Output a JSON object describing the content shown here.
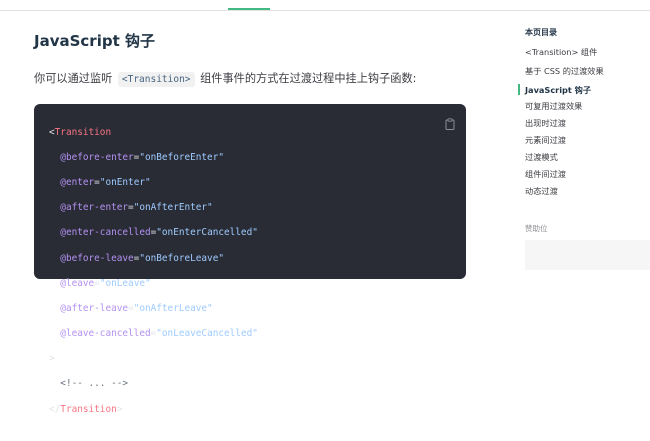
{
  "heading": "JavaScript 钩子",
  "intro": {
    "before": "你可以通过监听 ",
    "code": "<Transition>",
    "after": " 组件事件的方式在过渡过程中挂上钩子函数:"
  },
  "code": {
    "copy_icon": "clipboard-icon",
    "lines": [
      {
        "prefix": "<",
        "tag": "Transition"
      },
      {
        "attr": "@before-enter",
        "value": "\"onBeforeEnter\""
      },
      {
        "attr": "@enter",
        "value": "\"onEnter\""
      },
      {
        "attr": "@after-enter",
        "value": "\"onAfterEnter\""
      },
      {
        "attr": "@enter-cancelled",
        "value": "\"onEnterCancelled\""
      },
      {
        "attr": "@before-leave",
        "value": "\"onBeforeLeave\""
      },
      {
        "attr": "@leave",
        "value": "\"onLeave\""
      },
      {
        "attr": "@after-leave",
        "value": "\"onAfterLeave\""
      },
      {
        "attr": "@leave-cancelled",
        "value": "\"onLeaveCancelled\""
      },
      {
        "close": ">"
      },
      {
        "comment": "<!-- ... -->"
      },
      {
        "prefix": "</",
        "tag": "Transition",
        "suffix": ">"
      }
    ]
  },
  "outline": {
    "title": "本页目录",
    "items": [
      "<Transition> 组件",
      "基于 CSS 的过渡效果",
      "JavaScript 钩子",
      "可复用过渡效果",
      "出现时过渡",
      "元素间过渡",
      "过渡模式",
      "组件间过渡",
      "动态过渡"
    ],
    "active_index": 2
  },
  "sponsor": {
    "label": "赞助位"
  },
  "colors": {
    "accent": "#42b883",
    "code_bg": "#292b35"
  }
}
